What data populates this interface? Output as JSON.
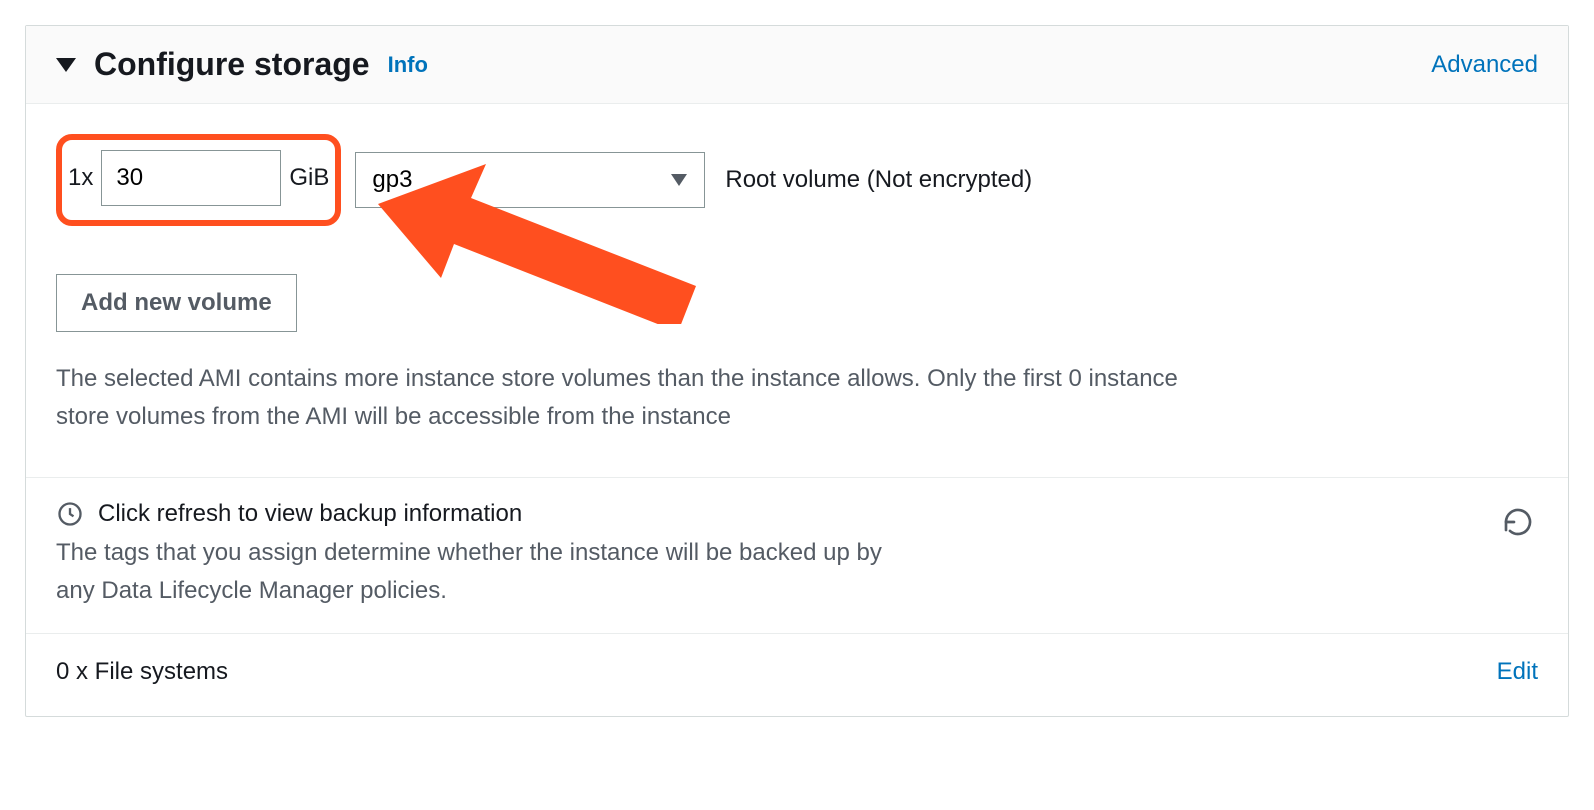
{
  "header": {
    "title": "Configure storage",
    "info_label": "Info",
    "advanced_label": "Advanced"
  },
  "volume": {
    "quantity_prefix": "1x",
    "size_value": "30",
    "unit": "GiB",
    "type_selected": "gp3",
    "description": "Root volume  (Not encrypted)"
  },
  "add_volume_label": "Add new volume",
  "ami_note": "The selected AMI contains more instance store volumes than the instance allows. Only the first 0 instance store volumes from the AMI will be accessible from the instance",
  "backup": {
    "title": "Click refresh to view backup information",
    "description": "The tags that you assign determine whether the instance will be backed up by any Data Lifecycle Manager policies."
  },
  "filesystems": {
    "label": "0 x File systems",
    "edit_label": "Edit"
  },
  "annotation_color": "#ff4f1f"
}
